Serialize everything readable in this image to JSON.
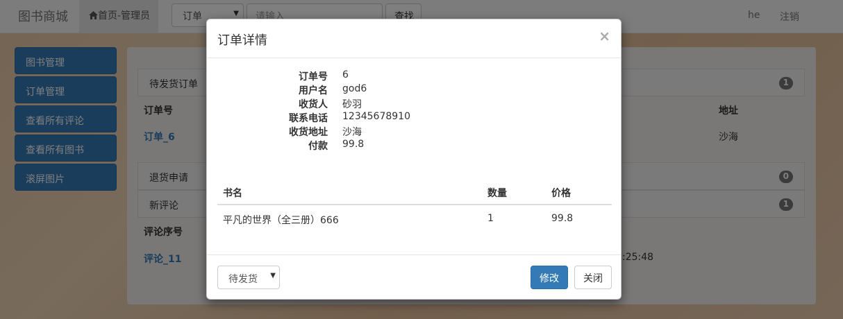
{
  "navbar": {
    "brand": "图书商城",
    "home_label": "首页-管理员",
    "search_type": "订单",
    "search_placeholder": "请输入",
    "search_button": "查找",
    "user": "he",
    "logout": "注销"
  },
  "sidebar": {
    "items": [
      {
        "label": "图书管理"
      },
      {
        "label": "订单管理"
      },
      {
        "label": "查看所有评论"
      },
      {
        "label": "查看所有图书"
      },
      {
        "label": "滚屏图片"
      }
    ]
  },
  "main": {
    "pending_orders": {
      "title": "待发货订单",
      "count": "1",
      "columns": [
        "订单号",
        "地址"
      ],
      "rows": [
        {
          "order": "订单_6",
          "address": "沙海"
        }
      ]
    },
    "returns": {
      "title": "退货申请",
      "count": "0"
    },
    "new_comments": {
      "title": "新评论",
      "count": "1",
      "columns": [
        "评论序号"
      ],
      "rows": [
        {
          "id": "评论_11",
          "time_fragment": ":25:48"
        }
      ]
    }
  },
  "modal": {
    "title": "订单详情",
    "close": "×",
    "details": [
      {
        "label": "订单号",
        "value": "6"
      },
      {
        "label": "用户名",
        "value": "god6"
      },
      {
        "label": "收货人",
        "value": "砂羽"
      },
      {
        "label": "联系电话",
        "value": "12345678910"
      },
      {
        "label": "收货地址",
        "value": "沙海"
      },
      {
        "label": "付款",
        "value": "99.8"
      }
    ],
    "items_table": {
      "columns": [
        "书名",
        "数量",
        "价格"
      ],
      "rows": [
        {
          "name": "平凡的世界（全三册）666",
          "qty": "1",
          "price": "99.8"
        }
      ]
    },
    "status_select": "待发货",
    "modify_button": "修改",
    "close_button": "关闭"
  },
  "colors": {
    "primary": "#337ab7",
    "badge": "#777777"
  }
}
